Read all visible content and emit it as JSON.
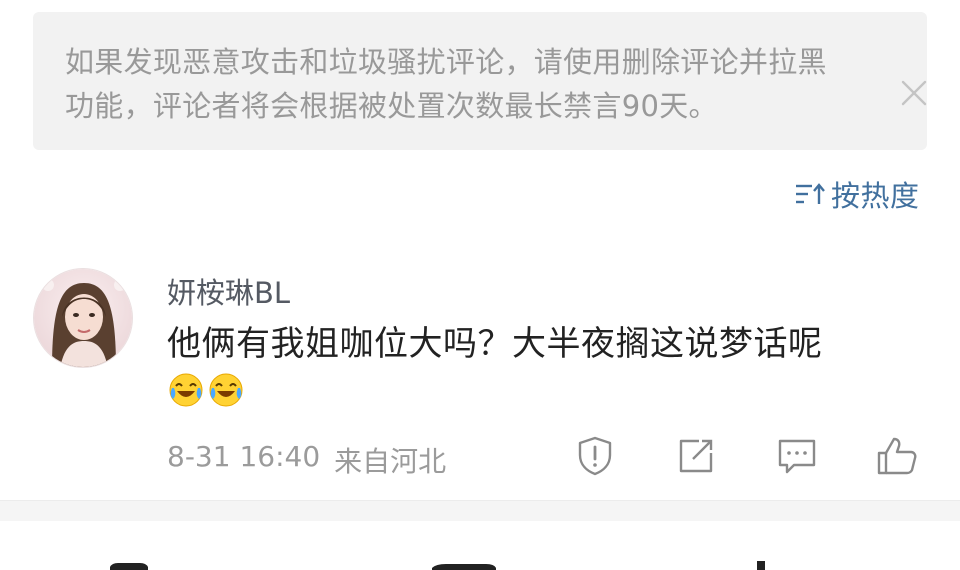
{
  "notice": {
    "text": "如果发现恶意攻击和垃圾骚扰评论，请使用删除评论并拉黑功能，评论者将会根据被处置次数最长禁言90天。"
  },
  "sort": {
    "label": "按热度",
    "icon": "sort-icon"
  },
  "comment": {
    "username": "妍桉琳BL",
    "text": "他俩有我姐咖位大吗？大半夜搁这说梦话呢",
    "emojis": [
      "laugh-cry-emoji",
      "laugh-cry-emoji"
    ],
    "date": "8-31 16:40",
    "location": "来自河北",
    "actions": [
      "report-icon",
      "share-icon",
      "reply-icon",
      "like-icon"
    ]
  },
  "colors": {
    "notice_bg": "#f2f2f2",
    "notice_text": "#999999",
    "link": "#41709e",
    "username": "#555a63",
    "body": "#222222",
    "meta": "#9b9b9b"
  }
}
